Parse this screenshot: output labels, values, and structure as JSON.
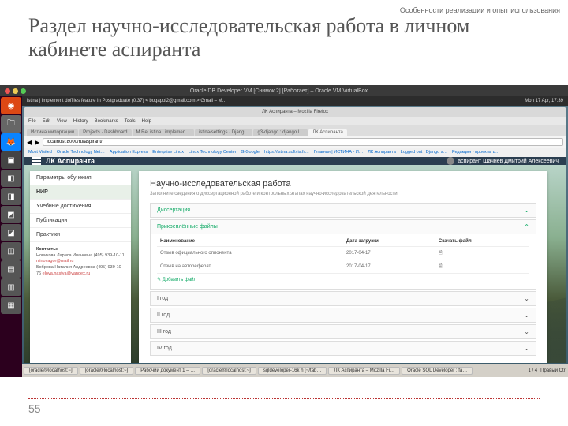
{
  "slide": {
    "header_note": "Особенности реализации и опыт использования",
    "title": "Раздел научно-исследовательская работа в личном кабинете аспиранта",
    "page_num": "55"
  },
  "vm": {
    "title": "Oracle DB Developer VM [Снимок 2] [Работает] – Oracle VM VirtualBox"
  },
  "ubuntu": {
    "topbar_left": "istina | implement doffiles feature in Postgraduate (0.37) < bogapol2@gmail.com > Gmail – M…",
    "topbar_right": "Mon 17 Apr, 17:39"
  },
  "ff": {
    "title": "ЛК Аспиранта – Mozilla Firefox",
    "menu": [
      "File",
      "Edit",
      "View",
      "History",
      "Bookmarks",
      "Tools",
      "Help"
    ],
    "tabs": [
      "Истина импортации",
      "Projects · Dashboard",
      "M Re: istina | implemen…",
      "istina/settings · Djang…",
      "g3-djangо : django.l…",
      "ЛК Аспиранта"
    ],
    "url": "localhost:8000/ru/aspirant/",
    "bookmarks": [
      "Most Visited",
      "Oracle Technology Net…",
      "Application Express",
      "Enterprise Linux",
      "Linux Technology Center",
      "G Google",
      "https://istina.softvis.fr…",
      "Главная | ИСТИНА - И…",
      "ЛК Аспиранта",
      "Logged out | Django s…",
      "Редакция - проекты ц…"
    ]
  },
  "app": {
    "brand": "ЛК Аспиранта",
    "user": "аспирант Шачнев Дмитрий Алексеевич",
    "sidebar": {
      "items": [
        "Параметры обучения",
        "НИР",
        "Учебные достижения",
        "Публикации",
        "Практики"
      ],
      "contacts_title": "Контакты:",
      "c1_name": "Новикова Лариса Ивановна (495) 939-10-11",
      "c1_mail": "nlinovagor@mail.ru",
      "c2_name": "Боброва Наталия Андреевна (495) 939-10-76",
      "c2_mail": "elova.nastya@yandex.ru"
    },
    "main": {
      "title": "Научно-исследовательская работа",
      "subtitle": "Заполните сведения о диссертационной работе и контрольных этапах научно-исследовательской деятельности",
      "acc": [
        "Диссертация",
        "Прикреплённые файлы",
        "I год",
        "II год",
        "III год",
        "IV год"
      ],
      "table": {
        "headers": [
          "Наименование",
          "Дата загрузки",
          "Скачать файл"
        ],
        "rows": [
          {
            "name": "Отзыв официального оппонента",
            "date": "2017-04-17"
          },
          {
            "name": "Отзыв на автореферат",
            "date": "2017-04-17"
          }
        ]
      },
      "add_file": "Добавить файл"
    }
  },
  "taskbar": {
    "items": [
      "[oracle@localhost:~]",
      "[oracle@localhost:~]",
      "Рабочий документ 1 – …",
      "[oracle@localhost:~]",
      "sqldeveloper-16k h [~/tab…",
      "ЛК Аспиранта – Mozilla Fi…",
      "Oracle SQL Developer : fa…"
    ],
    "pager": "1 / 4",
    "ctrl": "Правый Ctrl"
  }
}
